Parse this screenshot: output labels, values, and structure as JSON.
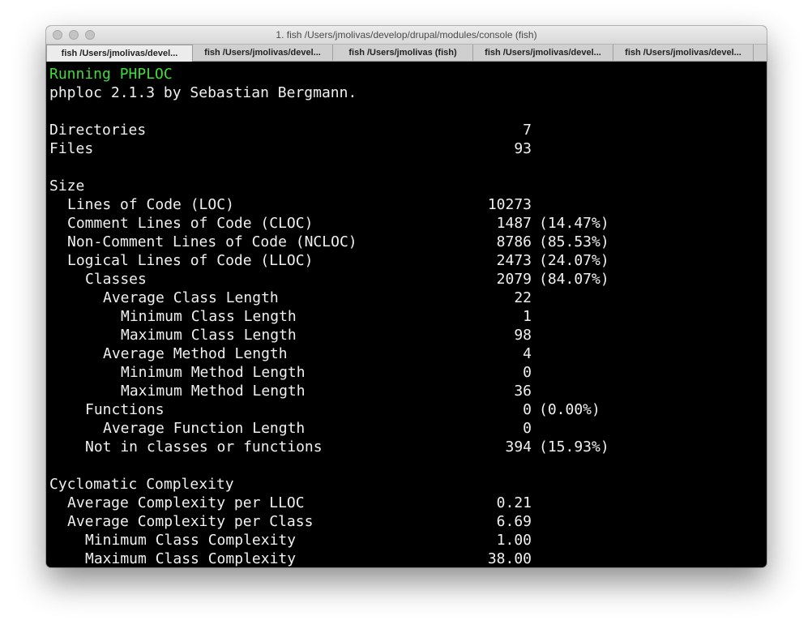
{
  "window": {
    "title": "1. fish  /Users/jmolivas/develop/drupal/modules/console (fish)",
    "tabs": [
      {
        "label": "fish  /Users/jmolivas/devel...",
        "active": true
      },
      {
        "label": "fish  /Users/jmolivas/devel...",
        "active": false
      },
      {
        "label": "fish  /Users/jmolivas (fish)",
        "active": false
      },
      {
        "label": "fish  /Users/jmolivas/devel...",
        "active": false
      },
      {
        "label": "fish  /Users/jmolivas/devel...",
        "active": false
      }
    ]
  },
  "terminal": {
    "header": "Running PHPLOC",
    "version": "phploc 2.1.3 by Sebastian Bergmann.",
    "lines": [
      {
        "label": "",
        "value": "",
        "pct": "",
        "indent": 0
      },
      {
        "label": "Directories",
        "value": "7",
        "pct": "",
        "indent": 0
      },
      {
        "label": "Files",
        "value": "93",
        "pct": "",
        "indent": 0
      },
      {
        "label": "",
        "value": "",
        "pct": "",
        "indent": 0
      },
      {
        "label": "Size",
        "value": "",
        "pct": "",
        "indent": 0
      },
      {
        "label": "Lines of Code (LOC)",
        "value": "10273",
        "pct": "",
        "indent": 1
      },
      {
        "label": "Comment Lines of Code (CLOC)",
        "value": "1487",
        "pct": "(14.47%)",
        "indent": 1
      },
      {
        "label": "Non-Comment Lines of Code (NCLOC)",
        "value": "8786",
        "pct": "(85.53%)",
        "indent": 1
      },
      {
        "label": "Logical Lines of Code (LLOC)",
        "value": "2473",
        "pct": "(24.07%)",
        "indent": 1
      },
      {
        "label": "Classes",
        "value": "2079",
        "pct": "(84.07%)",
        "indent": 2
      },
      {
        "label": "Average Class Length",
        "value": "22",
        "pct": "",
        "indent": 3
      },
      {
        "label": "Minimum Class Length",
        "value": "1",
        "pct": "",
        "indent": 4
      },
      {
        "label": "Maximum Class Length",
        "value": "98",
        "pct": "",
        "indent": 4
      },
      {
        "label": "Average Method Length",
        "value": "4",
        "pct": "",
        "indent": 3
      },
      {
        "label": "Minimum Method Length",
        "value": "0",
        "pct": "",
        "indent": 4
      },
      {
        "label": "Maximum Method Length",
        "value": "36",
        "pct": "",
        "indent": 4
      },
      {
        "label": "Functions",
        "value": "0",
        "pct": "(0.00%)",
        "indent": 2
      },
      {
        "label": "Average Function Length",
        "value": "0",
        "pct": "",
        "indent": 3
      },
      {
        "label": "Not in classes or functions",
        "value": "394",
        "pct": "(15.93%)",
        "indent": 2
      },
      {
        "label": "",
        "value": "",
        "pct": "",
        "indent": 0
      },
      {
        "label": "Cyclomatic Complexity",
        "value": "",
        "pct": "",
        "indent": 0
      },
      {
        "label": "Average Complexity per LLOC",
        "value": "0.21",
        "pct": "",
        "indent": 1
      },
      {
        "label": "Average Complexity per Class",
        "value": "6.69",
        "pct": "",
        "indent": 1
      },
      {
        "label": "Minimum Class Complexity",
        "value": "1.00",
        "pct": "",
        "indent": 2
      },
      {
        "label": "Maximum Class Complexity",
        "value": "38.00",
        "pct": "",
        "indent": 2
      }
    ]
  },
  "colors": {
    "terminal_background": "#000000",
    "terminal_text": "#f0f0f0",
    "header_text": "#3fdc3a"
  }
}
